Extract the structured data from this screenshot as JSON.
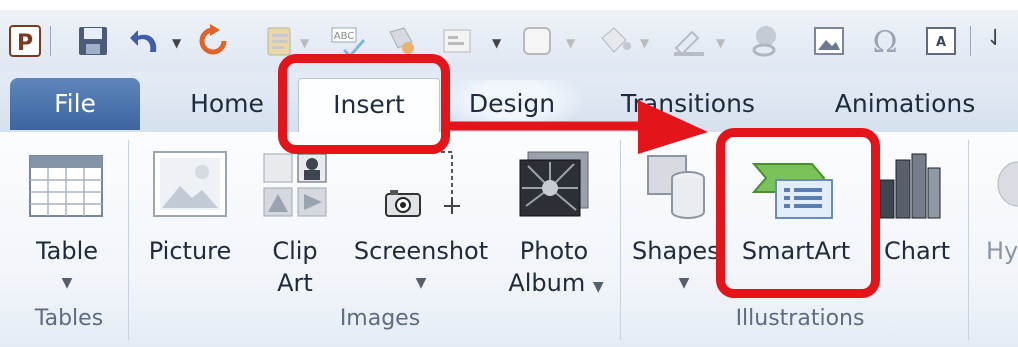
{
  "tabs": {
    "file": "File",
    "home": "Home",
    "insert": "Insert",
    "design": "Design",
    "transitions": "Transitions",
    "animations": "Animations"
  },
  "ribbon": {
    "tables": {
      "table_line1": "Table",
      "group_label": "Tables"
    },
    "images": {
      "picture": "Picture",
      "clip_art_line1": "Clip",
      "clip_art_line2": "Art",
      "screenshot": "Screenshot",
      "photo_album_line1": "Photo",
      "photo_album_line2": "Album",
      "group_label": "Images"
    },
    "illustrations": {
      "shapes": "Shapes",
      "smartart": "SmartArt",
      "chart": "Chart",
      "group_label": "Illustrations"
    },
    "cut_off_next": "Hy"
  },
  "icons": {
    "app": "powerpoint-icon",
    "save": "save-icon",
    "undo": "undo-icon",
    "redo": "redo-icon"
  },
  "colors": {
    "annotation_red": "#e3151b",
    "file_tab_blue": "#3c64a0",
    "smartart_green": "#58a33b"
  }
}
